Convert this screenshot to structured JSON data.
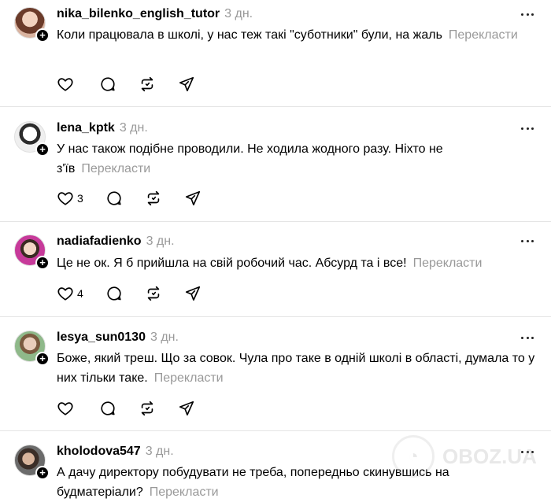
{
  "comments": [
    {
      "username": "nika_bilenko_english_tutor",
      "time": "3 дн.",
      "text": "Коли працювала в школі, у нас теж такі \"суботники\" були, на жаль",
      "translate": "Перекласти",
      "like_count": ""
    },
    {
      "username": "lena_kptk",
      "time": "3 дн.",
      "text": "У нас також подібне проводили. Не ходила жодного разу. Ніхто не з'їв",
      "translate": "Перекласти",
      "like_count": "3"
    },
    {
      "username": "nadiafadienko",
      "time": "3 дн.",
      "text": "Це не ок. Я б прийшла на свій робочий час. Абсурд та і все!",
      "translate": "Перекласти",
      "like_count": "4"
    },
    {
      "username": "lesya_sun0130",
      "time": "3 дн.",
      "text": "Боже, який треш. Що за совок. Чула про таке в одній школі в області, думала то у них тільки таке.",
      "translate": "Перекласти",
      "like_count": ""
    },
    {
      "username": "kholodova547",
      "time": "3 дн.",
      "text": "А дачу директору побудувати не треба, попередньо скинувшись на будматеріали?",
      "translate": "Перекласти",
      "like_count": ""
    }
  ],
  "follow_symbol": "+",
  "icons": [
    "heart-icon",
    "comment-icon",
    "repost-icon",
    "share-icon",
    "more-icon"
  ],
  "watermark": {
    "text": "OBOZ.UA"
  },
  "colors": {
    "text": "#000000",
    "muted": "#999999",
    "divider": "#e5e5e5"
  }
}
